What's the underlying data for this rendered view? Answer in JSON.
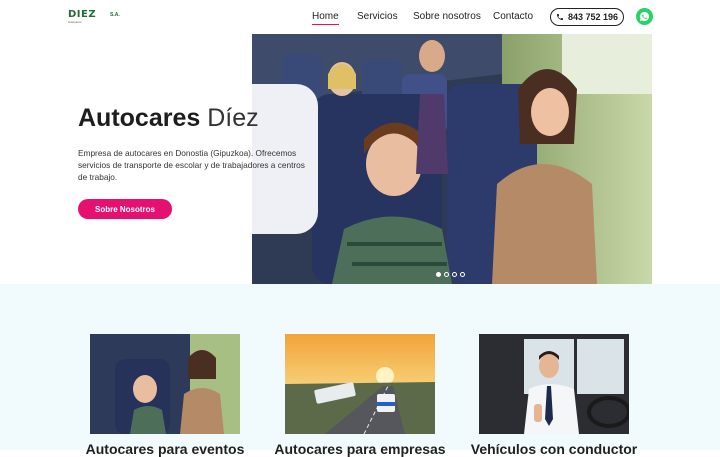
{
  "header": {
    "logo": {
      "word": "DIEZ",
      "suffix": "S.A.",
      "tagline": "Autocares"
    },
    "nav": [
      {
        "label": "Home",
        "active": true
      },
      {
        "label": "Servicios",
        "active": false
      },
      {
        "label": "Sobre nosotros",
        "active": false
      },
      {
        "label": "Contacto",
        "active": false
      }
    ],
    "phone": "843 752 196",
    "whatsapp_icon": "whatsapp-icon"
  },
  "hero": {
    "title_bold": "Autocares",
    "title_light": "Díez",
    "description": "Empresa de autocares en Donostia (Gipuzkoa). Ofrecemos servicios de transporte de escolar y de trabajadores a centros de trabajo.",
    "cta": "Sobre Nosotros",
    "slides": 4,
    "active_slide": 1
  },
  "services": [
    {
      "title": "Autocares para eventos"
    },
    {
      "title": "Autocares para empresas"
    },
    {
      "title": "Vehículos con conductor"
    }
  ],
  "colors": {
    "accent": "#e5106f",
    "brand_green": "#1f6b3a",
    "whatsapp": "#25d366",
    "section_bg": "#f1fafd"
  }
}
